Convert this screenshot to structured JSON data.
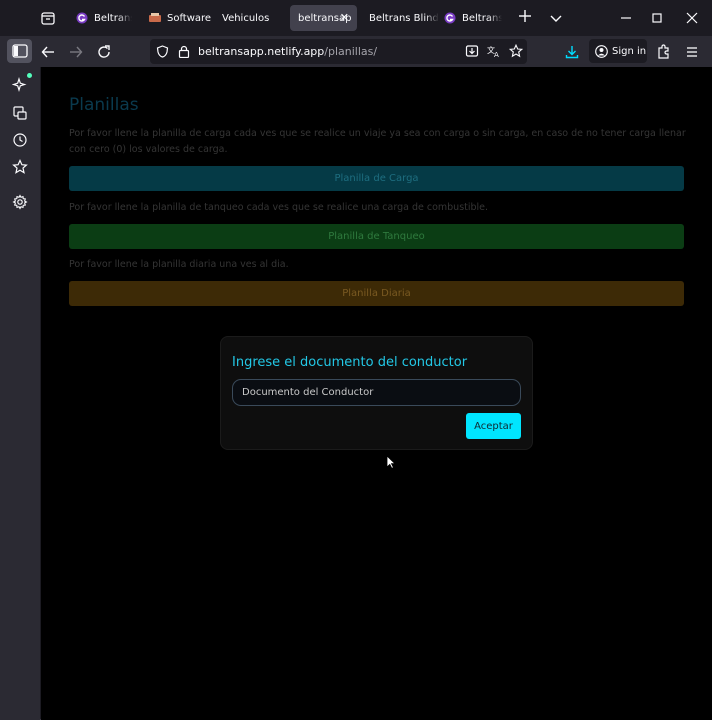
{
  "browser": {
    "tabs": [
      {
        "label": "Beltrans E",
        "icon": "site-favicon-icon",
        "active": false
      },
      {
        "label": "Software",
        "icon": "site-favicon-icon",
        "active": false
      },
      {
        "label": "Vehiculos",
        "icon": "",
        "active": false
      },
      {
        "label": "beltransap",
        "icon": "",
        "active": true
      },
      {
        "label": "Beltrans Blind",
        "icon": "",
        "active": false
      },
      {
        "label": "Beltrans E",
        "icon": "site-favicon-icon",
        "active": false
      }
    ],
    "url_host": "beltransapp.netlify.app",
    "url_path": "/planillas/",
    "signin_label": "Sign in"
  },
  "page": {
    "title": "Planillas",
    "carga_desc": "Por favor llene la planilla de carga cada ves que se realice un viaje ya sea con carga o sin carga, en caso de no tener carga llenar con cero (0) los valores de carga.",
    "carga_button": "Planilla de Carga",
    "tanqueo_desc": "Por favor llene la planilla de tanqueo cada ves que se realice una carga de combustible.",
    "tanqueo_button": "Planilla de Tanqueo",
    "diaria_desc": "Por favor llene la planilla diaria una ves al dia.",
    "diaria_button": "Planilla Diaria"
  },
  "modal": {
    "title": "Ingrese el documento del conductor",
    "input_placeholder": "Documento del Conductor",
    "input_value": "",
    "accept_label": "Aceptar"
  },
  "colors": {
    "accent": "#00e5ff",
    "carga_button": "#053a46",
    "tanqueo_button": "#0b3d14",
    "diaria_button": "#3d2a06"
  }
}
